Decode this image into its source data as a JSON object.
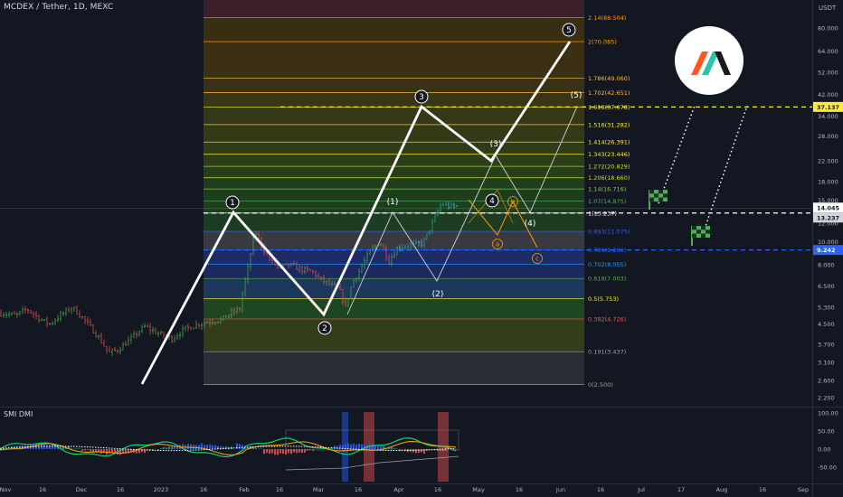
{
  "header": {
    "title": "MCDEX / Tether, 1D, MEXC",
    "unit": "USDT"
  },
  "indicator": {
    "name": "SMI DMI",
    "ticks": [
      "100.00",
      "50.00",
      "0.00",
      "-50.00"
    ]
  },
  "colors": {
    "background": "#131722",
    "bull": "#4caf50",
    "bear": "#ef5350",
    "blue": "#2962ff",
    "wave_main": "#ffffff",
    "wave_alt": "#ff9800",
    "target_line": "#ffeb3b",
    "support_line": "#2962ff",
    "flag": "#4caf50"
  },
  "logo": {
    "name": "mcdex-logo-icon"
  },
  "chart_data": {
    "type": "candlestick",
    "title": "MCDEX / Tether, 1D, MEXC",
    "ylabel": "USDT",
    "yscale": "log",
    "ylim": [
      1.9,
      160
    ],
    "y_ticks": [
      "80.000",
      "64.000",
      "52.000",
      "42.000",
      "34.000",
      "28.000",
      "22.000",
      "18.000",
      "15.000",
      "12.000",
      "10.000",
      "8.000",
      "6.500",
      "5.300",
      "4.500",
      "3.700",
      "3.100",
      "2.600",
      "2.200"
    ],
    "x_ticks": [
      "Nov",
      "16",
      "Dec",
      "16",
      "2023",
      "16",
      "Feb",
      "16",
      "Mar",
      "16",
      "Apr",
      "16",
      "May",
      "16",
      "Jun",
      "16",
      "Jul",
      "17",
      "Aug",
      "16",
      "Sep"
    ],
    "price_labels": [
      {
        "label": "37.137",
        "value": 37.137,
        "color": "#ffeb3b"
      },
      {
        "label": "14.045",
        "value": 14.045,
        "color": "#ffffff"
      },
      {
        "label": "13.237",
        "value": 13.237,
        "color": "#ffffff"
      },
      {
        "label": "9.242",
        "value": 9.242,
        "color": "#2962ff"
      }
    ],
    "fib_levels": [
      {
        "label": "2.14(88.504)",
        "value": 88.504
      },
      {
        "label": "2(70.085)",
        "value": 70.085
      },
      {
        "label": "1.786(49.060)",
        "value": 49.06
      },
      {
        "label": "1.702(42.651)",
        "value": 42.651
      },
      {
        "label": "1.618(37.078)",
        "value": 37.078
      },
      {
        "label": "1.516(31.282)",
        "value": 31.282
      },
      {
        "label": "1.414(26.391)",
        "value": 26.391
      },
      {
        "label": "1.343(23.446)",
        "value": 23.446
      },
      {
        "label": "1.272(20.829)",
        "value": 20.829
      },
      {
        "label": "1.206(18.660)",
        "value": 18.66
      },
      {
        "label": "1.14(16.716)",
        "value": 16.716
      },
      {
        "label": "1.07(14.875)",
        "value": 14.875
      },
      {
        "label": "1(13.237)",
        "value": 13.237
      },
      {
        "label": "0.893(11.075)",
        "value": 11.075
      },
      {
        "label": "0.786(9.266)",
        "value": 9.266
      },
      {
        "label": "0.702(8.055)",
        "value": 8.055
      },
      {
        "label": "0.618(7.003)",
        "value": 7.003
      },
      {
        "label": "0.5(5.753)",
        "value": 5.753
      },
      {
        "label": "0.382(4.726)",
        "value": 4.726
      },
      {
        "label": "0.191(3.437)",
        "value": 3.437
      },
      {
        "label": "0(2.500)",
        "value": 2.5
      }
    ],
    "wave_labels": [
      "1",
      "2",
      "3",
      "4",
      "5",
      "(1)",
      "(2)",
      "(3)",
      "(4)",
      "(5)",
      "a",
      "b",
      "c"
    ]
  }
}
